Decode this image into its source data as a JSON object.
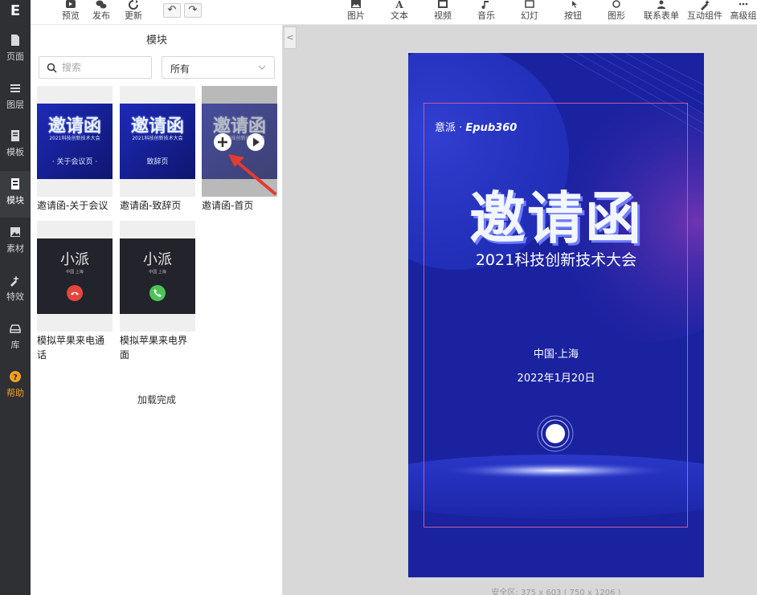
{
  "app": {
    "logo": "E"
  },
  "rail": [
    {
      "key": "page",
      "label": "页面",
      "icon": "page-icon"
    },
    {
      "key": "layers",
      "label": "图层",
      "icon": "layers-icon"
    },
    {
      "key": "template",
      "label": "模板",
      "icon": "template-icon"
    },
    {
      "key": "module",
      "label": "模块",
      "icon": "module-icon",
      "active": true
    },
    {
      "key": "assets",
      "label": "素材",
      "icon": "image-icon"
    },
    {
      "key": "effects",
      "label": "特效",
      "icon": "effects-icon"
    },
    {
      "key": "library",
      "label": "库",
      "icon": "library-icon"
    },
    {
      "key": "help",
      "label": "帮助",
      "icon": "help-icon"
    }
  ],
  "toolbar": {
    "preview": "预览",
    "publish": "发布",
    "update": "更新",
    "undo": "↶",
    "redo": "↷",
    "image": "图片",
    "text": "文本",
    "video": "视频",
    "music": "音乐",
    "slideshow": "幻灯",
    "button": "按钮",
    "shape": "图形",
    "form": "联系表单",
    "interactive": "互动组件",
    "advanced": "高级组"
  },
  "panel": {
    "title": "模块",
    "search_placeholder": "搜索",
    "filter_value": "所有",
    "loaded_text": "加载完成",
    "cards": [
      {
        "caption": "邀请函-关于会议",
        "thumb_title": "邀请函",
        "thumb_sub": "2021科技创新技术大会",
        "thumb_tag": "· 关于会议页 ·"
      },
      {
        "caption": "邀请函-致辞页",
        "thumb_title": "邀请函",
        "thumb_sub": "2021科技创新技术大会",
        "thumb_tag": "致辞页"
      },
      {
        "caption": "邀请函-首页",
        "thumb_title": "邀请函",
        "thumb_sub": "2021科技创新技术大会",
        "thumb_tag": ""
      },
      {
        "caption": "模拟苹果来电通话",
        "thumb_name": "小派",
        "thumb_loc": "中国 上海",
        "button_color": "#e5463b"
      },
      {
        "caption": "模拟苹果来电界面",
        "thumb_name": "小派",
        "thumb_loc": "中国 上海",
        "button_color": "#4cc35a"
      }
    ]
  },
  "canvas": {
    "collapse": "<",
    "brand_cn": "意派 · ",
    "brand_en": "Epub360",
    "title": "邀请函",
    "subtitle": "2021科技创新技术大会",
    "city": "中国·上海",
    "date": "2022年1月20日",
    "safe_area_label": "安全区: 375 x 603 ( 750 x 1206 )"
  },
  "colors": {
    "rail": "#2f3033",
    "page_blue": "#1a22a0",
    "frame": "#c25b9e",
    "accent_help": "#f0a020",
    "arrow": "#e53a2f"
  }
}
